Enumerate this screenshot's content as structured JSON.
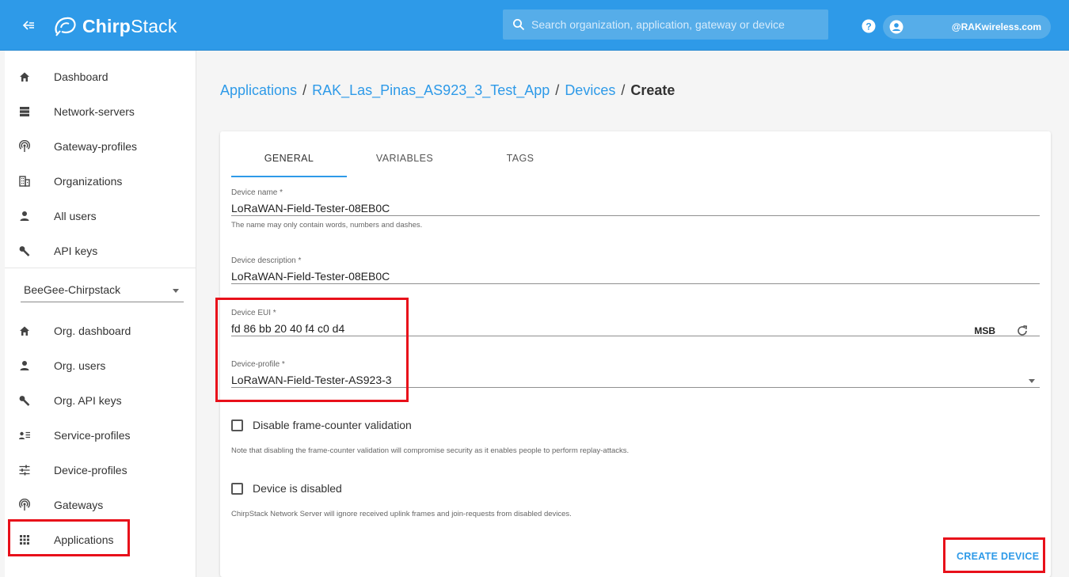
{
  "header": {
    "logo_text_bold": "Chirp",
    "logo_text_rest": "Stack",
    "search_placeholder": "Search organization, application, gateway or device",
    "user": "@RAKwireless.com"
  },
  "sidebar": {
    "global_items": [
      {
        "label": "Dashboard",
        "icon": "home-icon"
      },
      {
        "label": "Network-servers",
        "icon": "server-icon"
      },
      {
        "label": "Gateway-profiles",
        "icon": "antenna-icon"
      },
      {
        "label": "Organizations",
        "icon": "building-icon"
      },
      {
        "label": "All users",
        "icon": "person-icon"
      },
      {
        "label": "API keys",
        "icon": "key-icon"
      }
    ],
    "org_select": "BeeGee-Chirpstack",
    "org_items": [
      {
        "label": "Org. dashboard",
        "icon": "home-icon"
      },
      {
        "label": "Org. users",
        "icon": "person-icon"
      },
      {
        "label": "Org. API keys",
        "icon": "key-icon"
      },
      {
        "label": "Service-profiles",
        "icon": "account-list-icon"
      },
      {
        "label": "Device-profiles",
        "icon": "tune-icon"
      },
      {
        "label": "Gateways",
        "icon": "antenna-icon"
      },
      {
        "label": "Applications",
        "icon": "apps-grid-icon"
      }
    ]
  },
  "breadcrumb": {
    "applications": "Applications",
    "app_name": "RAK_Las_Pinas_AS923_3_Test_App",
    "devices": "Devices",
    "current": "Create",
    "separator": "/"
  },
  "tabs": [
    "GENERAL",
    "VARIABLES",
    "TAGS"
  ],
  "form": {
    "device_name_label": "Device name *",
    "device_name_value": "LoRaWAN-Field-Tester-08EB0C",
    "device_name_help": "The name may only contain words, numbers and dashes.",
    "device_description_label": "Device description *",
    "device_description_value": "LoRaWAN-Field-Tester-08EB0C",
    "device_eui_label": "Device EUI *",
    "device_eui_value": "fd 86 bb 20 40 f4 c0 d4",
    "byte_order": "MSB",
    "device_profile_label": "Device-profile *",
    "device_profile_value": "LoRaWAN-Field-Tester-AS923-3",
    "disable_fcnt_label": "Disable frame-counter validation",
    "disable_fcnt_help": "Note that disabling the frame-counter validation will compromise security as it enables people to perform replay-attacks.",
    "device_disabled_label": "Device is disabled",
    "device_disabled_help": "ChirpStack Network Server will ignore received uplink frames and join-requests from disabled devices.",
    "create_button": "CREATE DEVICE"
  },
  "colors": {
    "primary": "#2e9ae8",
    "highlight": "#e8101a"
  }
}
